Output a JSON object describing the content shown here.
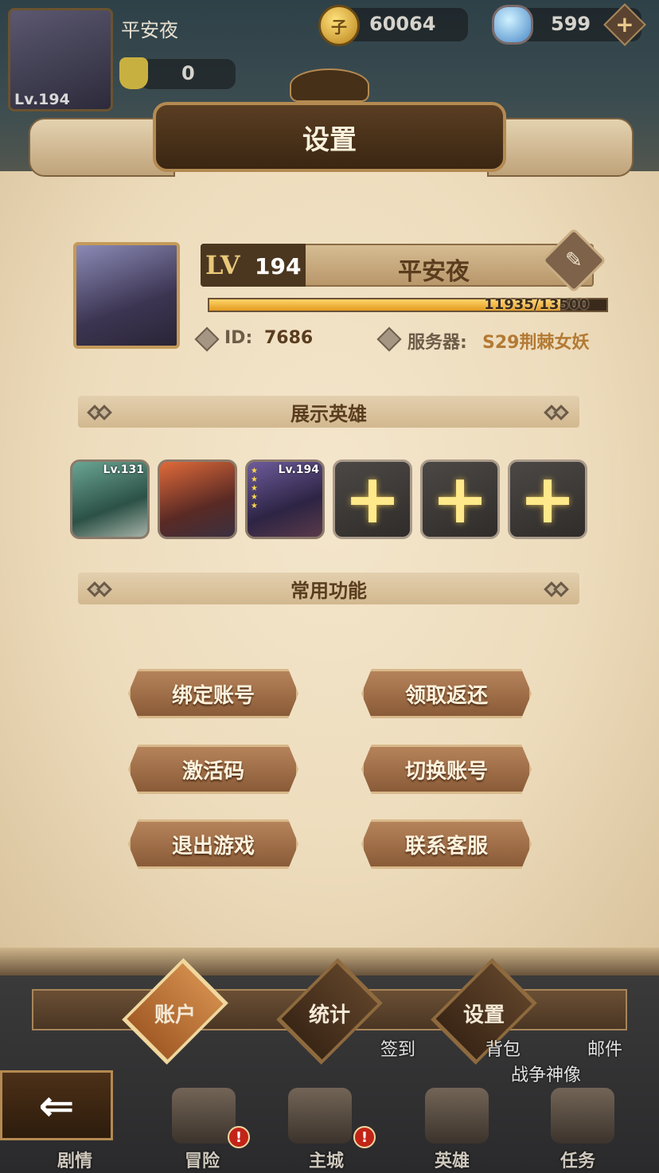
{
  "hud": {
    "player_name": "平安夜",
    "player_level": "Lv.194",
    "fist_count": "0",
    "gold": "60064",
    "gold_icon_glyph": "子",
    "gems": "599"
  },
  "title": "设置",
  "profile": {
    "lv_label": "LV",
    "level": "194",
    "name": "平安夜",
    "exp_text": "11935/13500",
    "exp_current": 11935,
    "exp_max": 13500,
    "id_label": "ID:",
    "id_value": "7686",
    "server_label": "服务器:",
    "server_value": "S29荆棘女妖"
  },
  "sections": {
    "heroes_title": "展示英雄",
    "functions_title": "常用功能"
  },
  "heroes": [
    {
      "level": "Lv.131",
      "empty": false
    },
    {
      "level": "",
      "empty": false
    },
    {
      "level": "Lv.194",
      "empty": false
    },
    {
      "level": "",
      "empty": true
    },
    {
      "level": "",
      "empty": true
    },
    {
      "level": "",
      "empty": true
    }
  ],
  "functions": {
    "bind_account": "绑定账号",
    "claim_rebate": "领取返还",
    "activation_code": "激活码",
    "switch_account": "切换账号",
    "exit_game": "退出游戏",
    "contact_support": "联系客服"
  },
  "tabs": {
    "account": "账户",
    "stats": "统计",
    "settings": "设置",
    "active": "account"
  },
  "scene": {
    "signin": "签到",
    "bag": "背包",
    "mail": "邮件",
    "war_statue": "战争神像"
  },
  "nav": {
    "story": "剧情",
    "adventure": "冒险",
    "main_city": "主城",
    "heroes": "英雄",
    "tasks": "任务",
    "alert_glyph": "!"
  },
  "colors": {
    "accent_gold": "#e29b1f",
    "active_tab": "#a35c26",
    "alert": "#c22418"
  }
}
